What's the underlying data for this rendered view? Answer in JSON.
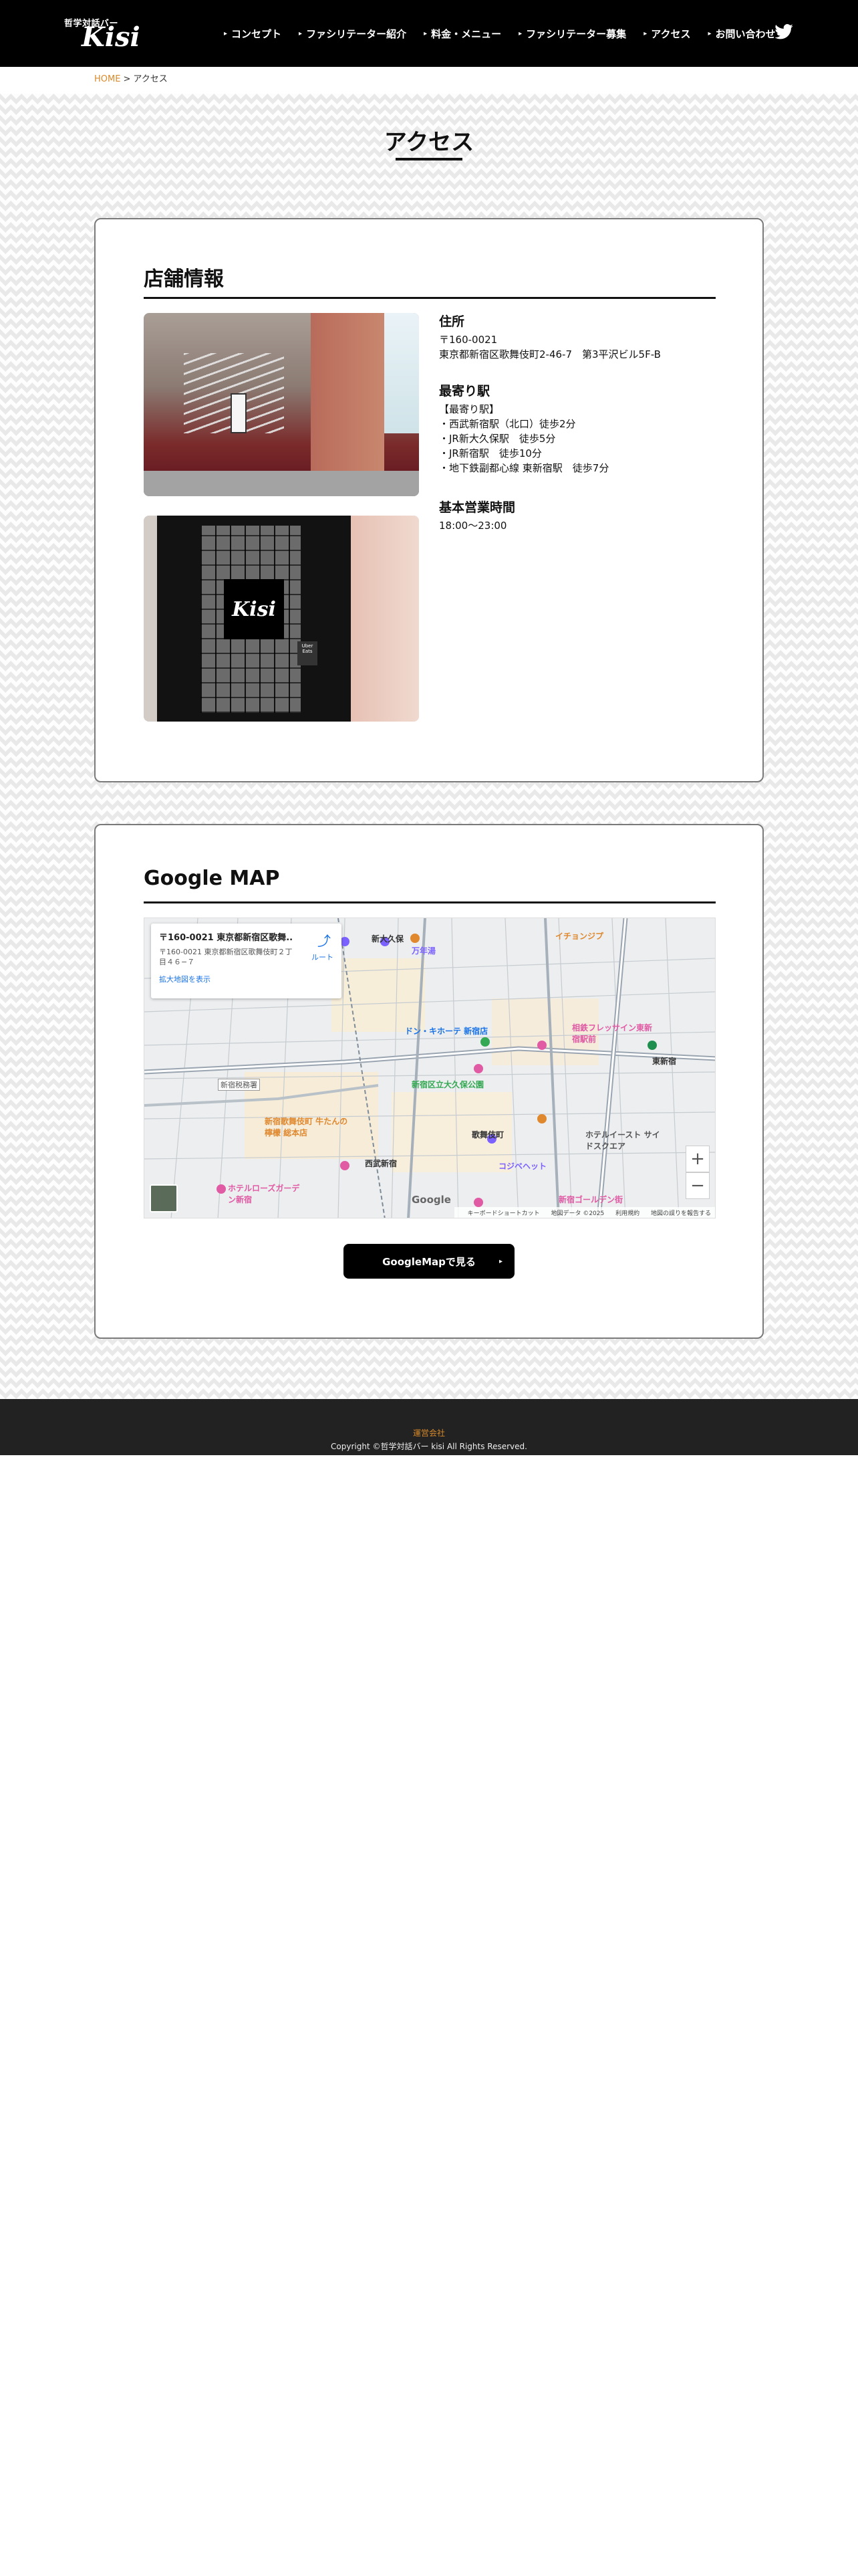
{
  "header": {
    "logo_sub": "哲学対話バー",
    "logo_main": "Kisi",
    "nav": [
      {
        "label": "コンセプト"
      },
      {
        "label": "ファシリテーター紹介"
      },
      {
        "label": "料金・メニュー"
      },
      {
        "label": "ファシリテーター募集"
      },
      {
        "label": "アクセス"
      },
      {
        "label": "お問い合わせ"
      }
    ],
    "social_icon": "twitter-bird-icon"
  },
  "breadcrumb": {
    "home": "HOME",
    "separator": ">",
    "current": "アクセス"
  },
  "page_title": "アクセス",
  "store": {
    "heading": "店舗情報",
    "address_heading": "住所",
    "address_lines": [
      "〒160-0021",
      "東京都新宿区歌舞伎町2-46-7　第3平沢ビル5F-B"
    ],
    "station_heading": "最寄り駅",
    "station_lines": [
      "【最寄り駅】",
      "・西武新宿駅（北口）徒歩2分",
      "・JR新大久保駅　徒歩5分",
      "・JR新宿駅　徒歩10分",
      "・地下鉄副都心線 東新宿駅　徒歩7分"
    ],
    "hours_heading": "基本営業時間",
    "hours": "18:00〜23:00",
    "door_sign": "Kisi",
    "door_sticker": "Uber Eats"
  },
  "map_section": {
    "heading": "Google MAP",
    "card_title": "〒160-0021 東京都新宿区歌舞...",
    "card_address": "〒160-0021 東京都新宿区歌舞伎町２丁目４６−７",
    "card_link": "拡大地図を表示",
    "directions_label": "ルート",
    "labels": [
      "新大久保",
      "万年湯",
      "イチョンジプ",
      "ドン・キホーテ 新宿店",
      "相鉄フレッサイン東新宿駅前",
      "東新宿",
      "新宿区立大久保公園",
      "歌舞伎町",
      "コジベヘット",
      "西武新宿",
      "新宿歌舞伎町 牛たんの檸檬 総本店",
      "ホテルローズガーデン新宿",
      "ホテルイースト サイドスクエア",
      "新宿ゴールデン街",
      "新宿税務署"
    ],
    "google_logo": "Google",
    "attribution": [
      "キーボードショートカット",
      "地図データ ©2025",
      "利用規約",
      "地図の誤りを報告する"
    ],
    "zoom_in": "+",
    "zoom_out": "−",
    "button_label": "GoogleMapで見る"
  },
  "footer": {
    "company": "運営会社",
    "copyright": "Copyright ©哲学対話バー kisi All Rights Reserved."
  }
}
